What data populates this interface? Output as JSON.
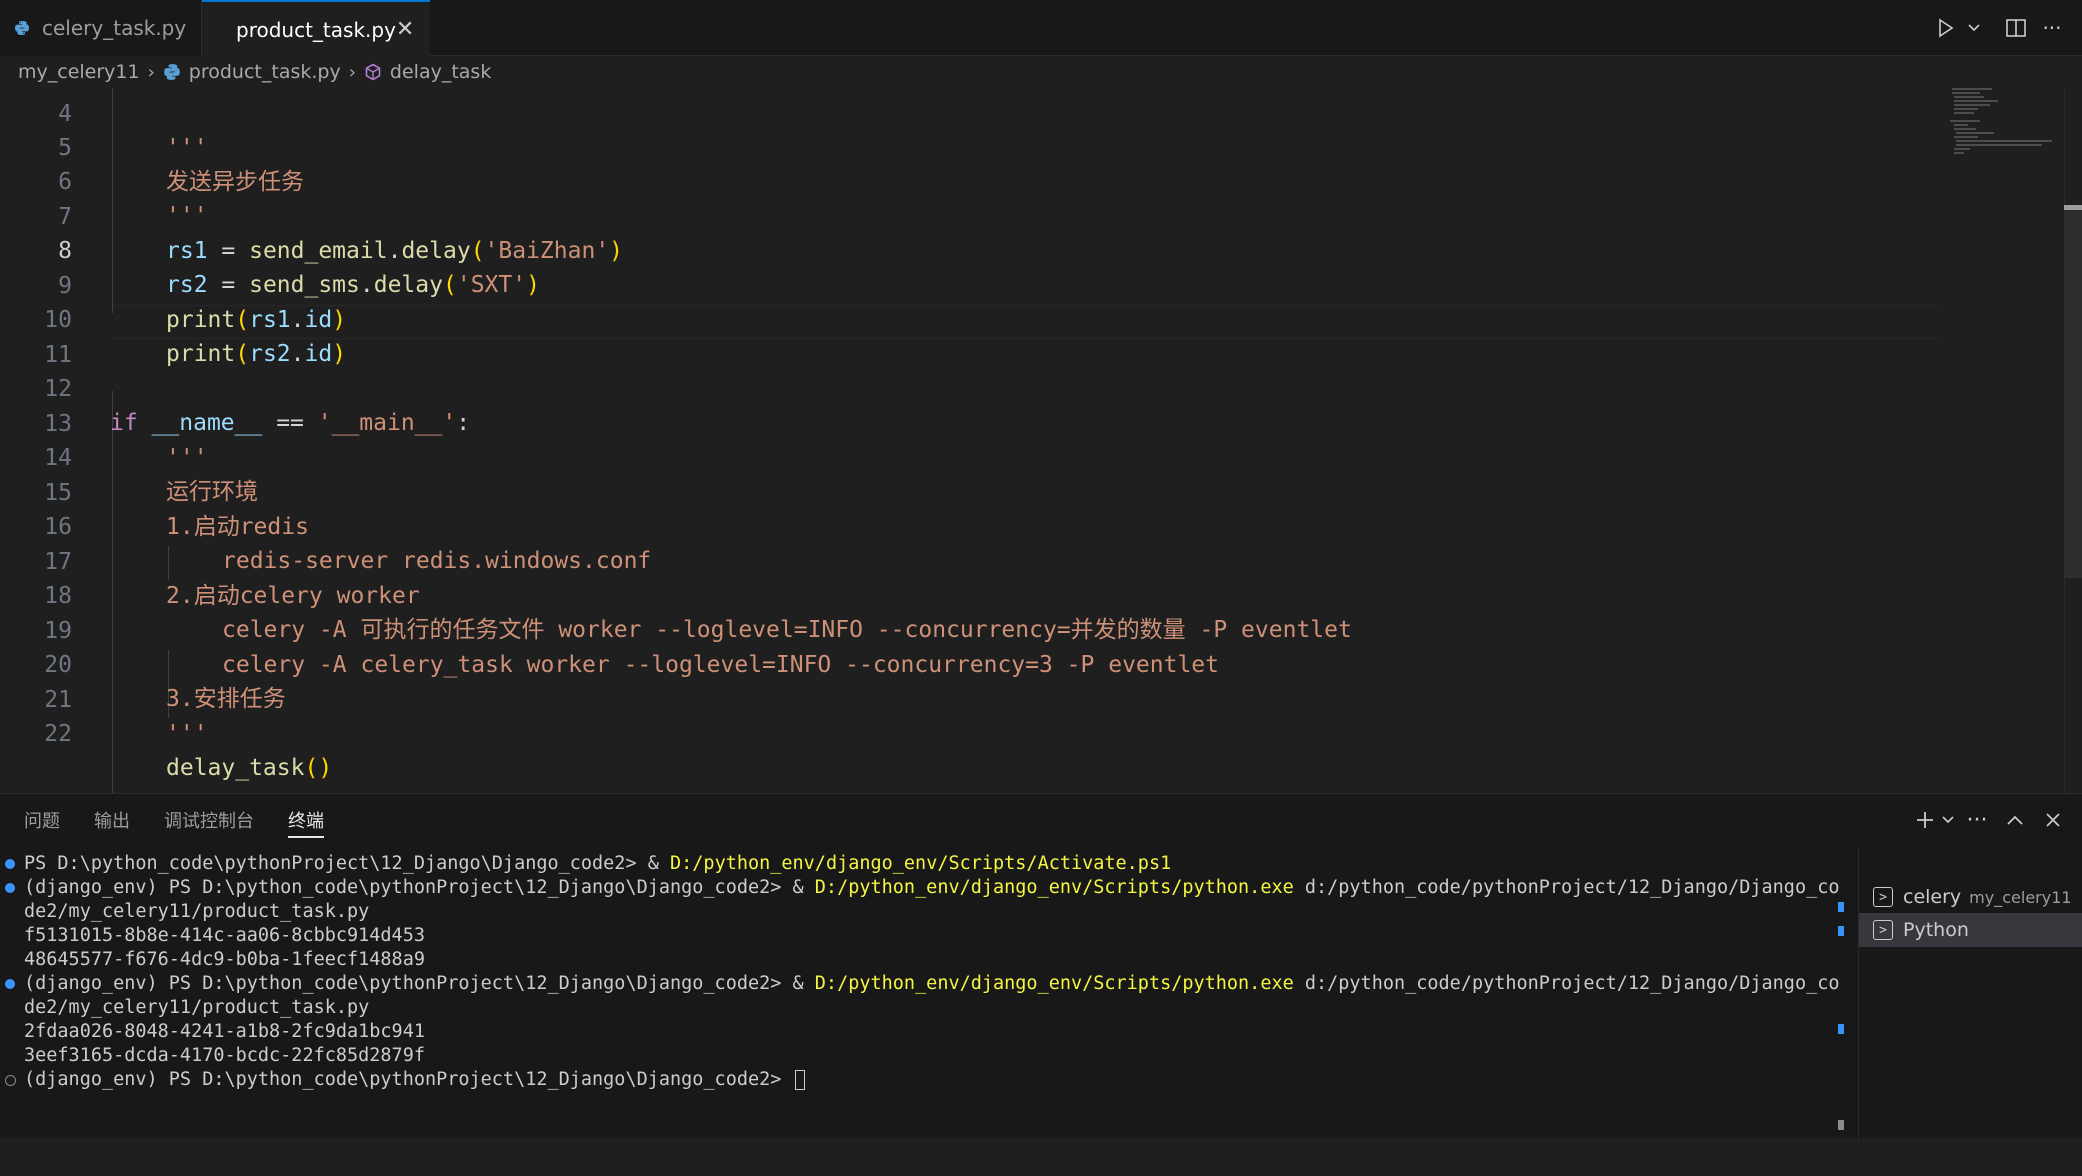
{
  "tabs": [
    {
      "label": "celery_task.py",
      "icon": "python-file-icon",
      "active": false
    },
    {
      "label": "product_task.py",
      "icon": "python-file-icon",
      "active": true
    }
  ],
  "breadcrumb": [
    "my_celery11",
    "product_task.py",
    "delay_task"
  ],
  "editor": {
    "current_line": 8,
    "lines": [
      {
        "n": "4",
        "text": "'''"
      },
      {
        "n": "5",
        "text": "发送异步任务"
      },
      {
        "n": "6",
        "text": "'''"
      },
      {
        "n": "7",
        "text": "rs1 = send_email.delay('BaiZhan')"
      },
      {
        "n": "8",
        "text": "rs2 = send_sms.delay('SXT')"
      },
      {
        "n": "9",
        "text": "print(rs1.id)"
      },
      {
        "n": "10",
        "text": "print(rs2.id)"
      },
      {
        "n": "11",
        "text": ""
      },
      {
        "n": "12",
        "text": "if __name__ == '__main__':"
      },
      {
        "n": "13",
        "text": "'''"
      },
      {
        "n": "14",
        "text": "运行环境"
      },
      {
        "n": "15",
        "text": "1.启动redis"
      },
      {
        "n": "16",
        "text": "redis-server redis.windows.conf"
      },
      {
        "n": "17",
        "text": "2.启动celery worker"
      },
      {
        "n": "18",
        "text": "celery -A 可执行的任务文件 worker --loglevel=INFO --concurrency=并发的数量 -P eventlet"
      },
      {
        "n": "19",
        "text": "celery -A celery_task worker --loglevel=INFO --concurrency=3 -P eventlet"
      },
      {
        "n": "20",
        "text": "3.安排任务"
      },
      {
        "n": "21",
        "text": "'''"
      },
      {
        "n": "22",
        "text": "delay_task()"
      }
    ]
  },
  "panel": {
    "tabs": [
      "问题",
      "输出",
      "调试控制台",
      "终端"
    ],
    "active_tab": "终端"
  },
  "terminal": {
    "l1_prefix": "PS D:\\python_code\\pythonProject\\12_Django\\Django_code2> & ",
    "l1_path": "D:/python_env/django_env/Scripts/Activate.ps1",
    "l2_prefix": "(django_env) PS D:\\python_code\\pythonProject\\12_Django\\Django_code2> & ",
    "l2_path": "D:/python_env/django_env/Scripts/python.exe",
    "l2_arg": " d:/python_code/pythonProject/12_Django/Django_co",
    "l2_wrap": "de2/my_celery11/product_task.py",
    "l3": "f5131015-8b8e-414c-aa06-8cbbc914d453",
    "l4": "48645577-f676-4dc9-b0ba-1feecf1488a9",
    "l5_prefix": "(django_env) PS D:\\python_code\\pythonProject\\12_Django\\Django_code2> & ",
    "l5_path": "D:/python_env/django_env/Scripts/python.exe",
    "l5_arg": " d:/python_code/pythonProject/12_Django/Django_co",
    "l5_wrap": "de2/my_celery11/product_task.py",
    "l6": "2fdaa026-8048-4241-a1b8-2fc9da1bc941",
    "l7": "3eef3165-dcda-4170-bcdc-22fc85d2879f",
    "l8": "(django_env) PS D:\\python_code\\pythonProject\\12_Django\\Django_code2> "
  },
  "terminal_list": [
    {
      "name": "celery",
      "sub": "my_celery11",
      "selected": false
    },
    {
      "name": "Python",
      "sub": "",
      "selected": true
    }
  ],
  "colors": {
    "string": "#ce9178",
    "variable": "#9cdcfe",
    "function": "#dcdcaa",
    "keyword": "#c586c0",
    "bracket": "#ffd700",
    "terminal_path": "#f5f543",
    "accent": "#0078d4"
  }
}
